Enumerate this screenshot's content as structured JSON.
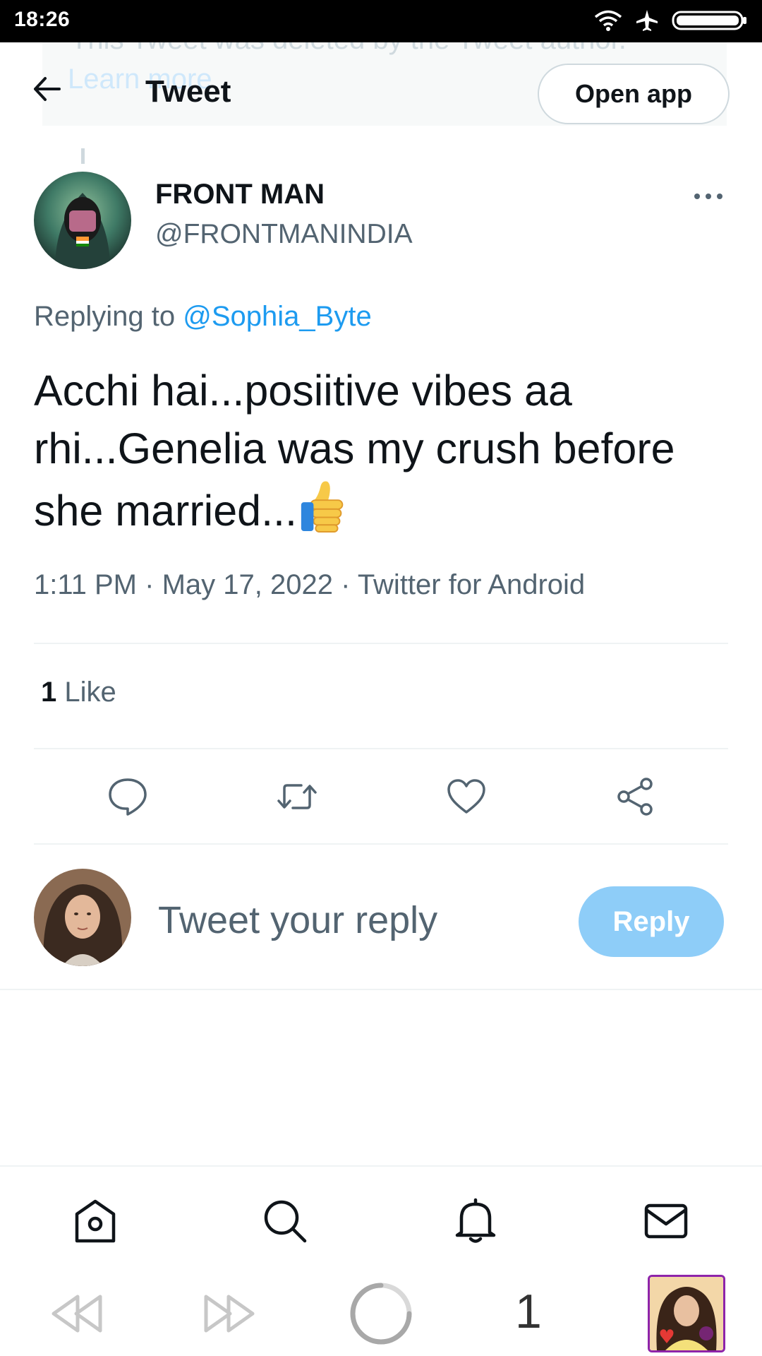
{
  "status_bar": {
    "time": "18:26",
    "icons": [
      "wifi-icon",
      "airplane-icon",
      "battery-icon"
    ]
  },
  "banner": {
    "text": "This Tweet was deleted by the Tweet author.",
    "link": "Learn more"
  },
  "header": {
    "title": "Tweet",
    "open_app_label": "Open app"
  },
  "tweet": {
    "author_name": "FRONT MAN",
    "author_handle": "@FRONTMANINDIA",
    "replying_prefix": "Replying to",
    "replying_to": "@Sophia_Byte",
    "text": "Acchi hai...posiitive vibes aa rhi...Genelia was my crush before she married...",
    "emoji": "thumbs-up",
    "time": "1:11 PM",
    "date": "May 17, 2022",
    "source": "Twitter for Android",
    "separator": "·",
    "like_count": "1",
    "like_label": "Like"
  },
  "actions": [
    "reply-icon",
    "retweet-icon",
    "like-icon",
    "share-icon"
  ],
  "reply_box": {
    "placeholder": "Tweet your reply",
    "button_label": "Reply"
  },
  "bottom_nav": [
    "home-icon",
    "search-icon",
    "notifications-icon",
    "messages-icon"
  ],
  "browser_bar": {
    "tab_count": "1"
  },
  "colors": {
    "accent": "#1d9bf0",
    "reply_button_disabled": "#8ecdf8",
    "text_secondary": "#536471",
    "divider": "#eff3f4"
  }
}
